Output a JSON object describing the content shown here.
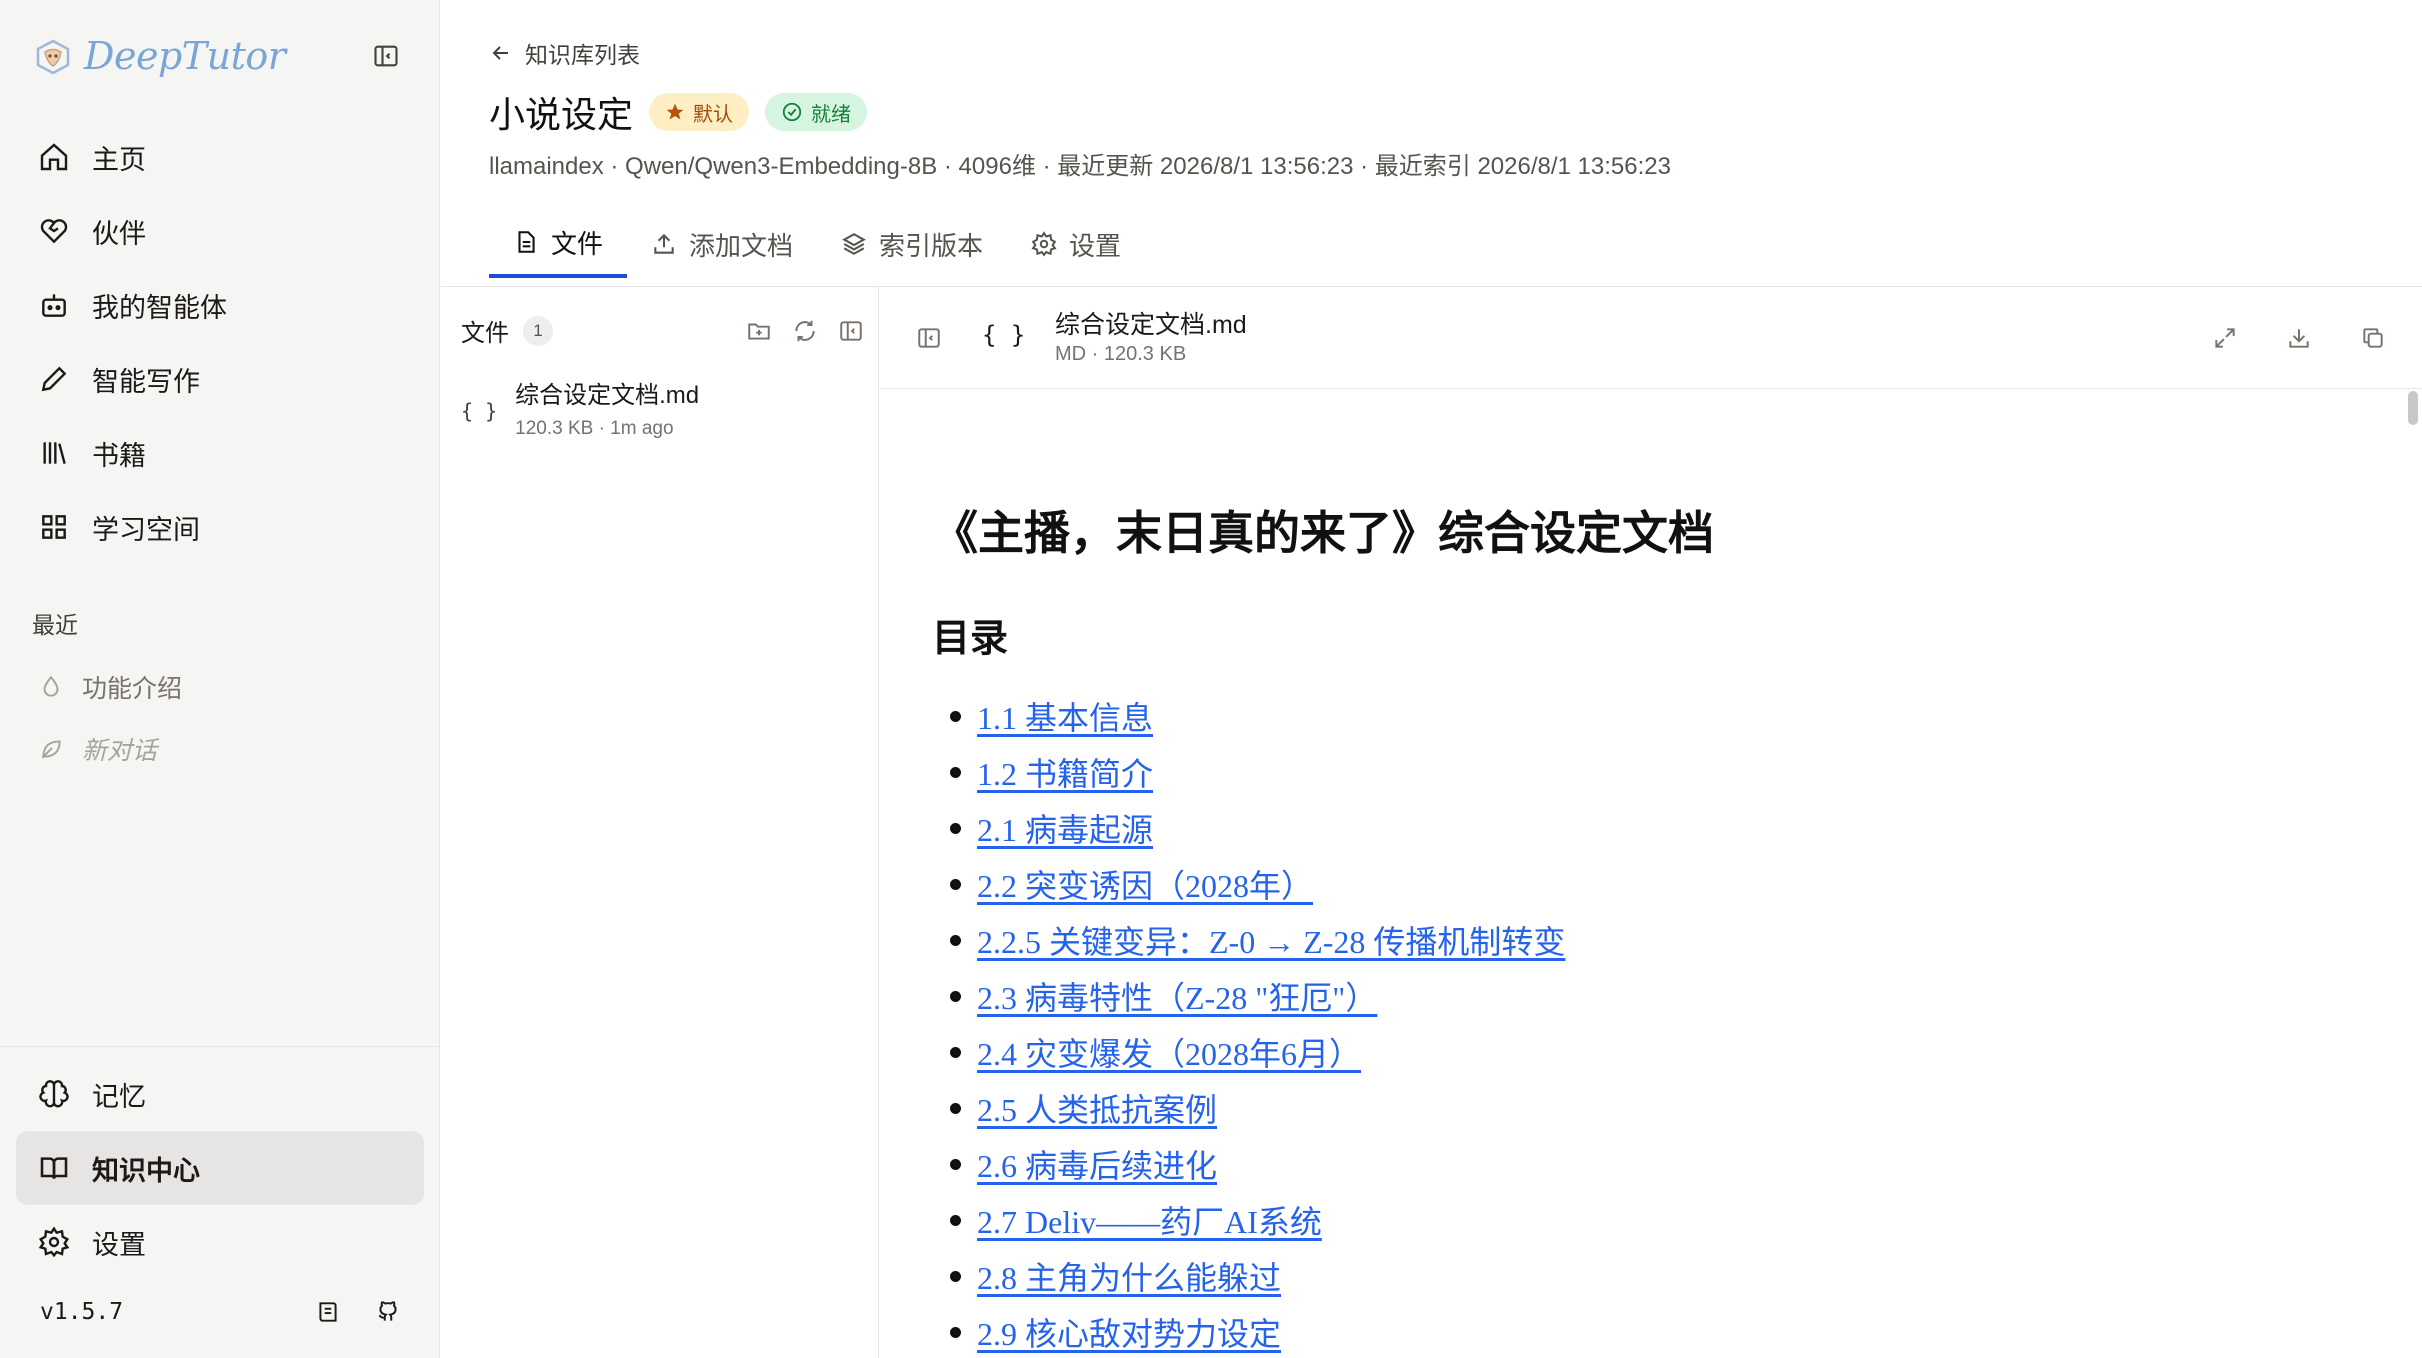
{
  "app": {
    "brand": "DeepTutor",
    "version": "v1.5.7",
    "colors": {
      "accent": "#1d4ed8",
      "link": "#2563eb",
      "sidebar_bg": "#f5f5f4"
    }
  },
  "sidebar": {
    "nav": [
      {
        "label": "主页",
        "icon": "home-icon"
      },
      {
        "label": "伙伴",
        "icon": "heart-handshake-icon"
      },
      {
        "label": "我的智能体",
        "icon": "bot-icon"
      },
      {
        "label": "智能写作",
        "icon": "pen-icon"
      },
      {
        "label": "书籍",
        "icon": "library-icon"
      },
      {
        "label": "学习空间",
        "icon": "grid-icon"
      }
    ],
    "recent_title": "最近",
    "recent": [
      {
        "label": "功能介绍",
        "icon": "droplet-icon"
      },
      {
        "label": "新对话",
        "icon": "leaf-icon"
      }
    ],
    "bottom": [
      {
        "label": "记忆",
        "icon": "brain-icon"
      },
      {
        "label": "知识中心",
        "icon": "book-open-icon",
        "active": true
      },
      {
        "label": "设置",
        "icon": "gear-icon"
      }
    ]
  },
  "header": {
    "back_label": "知识库列表",
    "title": "小说设定",
    "badge_default": "默认",
    "badge_ready": "就绪",
    "meta": "llamaindex · Qwen/Qwen3-Embedding-8B · 4096维 · 最近更新 2026/8/1 13:56:23 · 最近索引 2026/8/1 13:56:23",
    "tabs": [
      {
        "label": "文件",
        "icon": "file-icon",
        "active": true
      },
      {
        "label": "添加文档",
        "icon": "upload-icon"
      },
      {
        "label": "索引版本",
        "icon": "layers-icon"
      },
      {
        "label": "设置",
        "icon": "gear-icon"
      }
    ]
  },
  "files": {
    "title": "文件",
    "count": "1",
    "items": [
      {
        "name": "综合设定文档.md",
        "meta": "120.3 KB · 1m ago",
        "icon": "{ }"
      }
    ]
  },
  "preview": {
    "file_name": "综合设定文档.md",
    "file_meta": "MD · 120.3 KB",
    "braces": "{ }",
    "doc_title": "《主播，末日真的来了》综合设定文档",
    "toc_title": "目录",
    "toc": [
      "1.1 基本信息",
      "1.2 书籍简介",
      "2.1 病毒起源",
      "2.2 突变诱因（2028年）",
      "2.2.5 关键变异：Z-0 → Z-28 传播机制转变",
      "2.3 病毒特性（Z-28 \"狂厄\"）",
      "2.4 灾变爆发（2028年6月）",
      "2.5 人类抵抗案例",
      "2.6 病毒后续进化",
      "2.7 Deliv——药厂AI系统",
      "2.8 主角为什么能躲过",
      "2.9 核心敌对势力设定"
    ]
  }
}
